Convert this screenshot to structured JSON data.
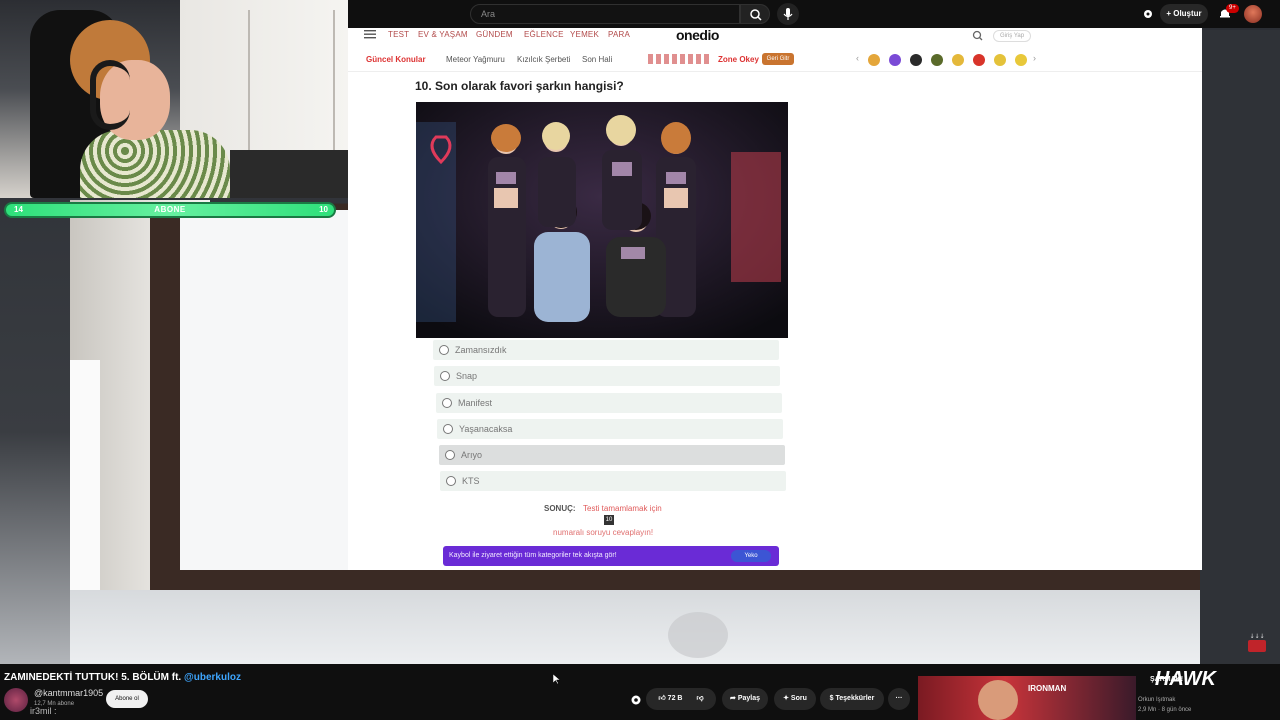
{
  "youtube_bar": {
    "search_placeholder": "Ara",
    "create_label": "Oluştur",
    "notif_badge": "9+"
  },
  "onedio": {
    "nav_top": [
      "TEST",
      "EV & YAŞAM",
      "GÜNDEM",
      "EĞLENCE",
      "YEMEK",
      "PARA"
    ],
    "logo": "onedio",
    "login_label": "Giriş Yap",
    "nav_second": {
      "current_topics": "Güncel Konular",
      "items": [
        "Meteor Yağmuru",
        "Kızılcık Şerbeti",
        "Son Hali"
      ],
      "zone_label": "Zone Okey",
      "zone_button": "Geri Gitr"
    },
    "question": "10. Son olarak favori şarkın hangisi?",
    "options": [
      "Zamansızdık",
      "Snap",
      "Manifest",
      "Yaşanacaksa",
      "Arıyo",
      "KTS"
    ],
    "result_label": "SONUÇ:",
    "result_text": "Testi tamamlamak için",
    "result_count": "10",
    "result_text2": "numaralı soruyu cevaplayın!",
    "promo_text": "Kaybol ile ziyaret ettiğin tüm kategoriler tek akışta gör!",
    "promo_badge": "Yeko"
  },
  "stream_overlay": {
    "goal_left": "14",
    "goal_label": "ABONE",
    "goal_right": "10"
  },
  "video_info": {
    "title_prefix": "ZAMINEDEKTİ TUTTUK! 5. BÖLÜM ft. ",
    "title_mention": "@uberkuloz",
    "channel_name": "@kantmmar1905",
    "channel_subs": "12,7 Mn abone",
    "channel_extra": "ir3mil :",
    "subscribe_label": "Abone ol",
    "likes": "72 B",
    "share_label": "Paylaş",
    "ask_label": "Soru",
    "thanks_label": "Teşekkürler",
    "more_label": "···"
  },
  "sidebar_video": {
    "ad_title": "IRONMAN",
    "title": "ŞARMAK!",
    "channel": "Orkun Işıtmak",
    "meta": "2,9 Mn · 8 gün önce",
    "logo": "HAWK"
  },
  "colors": {
    "goal_green": "#2ee07a",
    "promo_purple": "#6a2bd6",
    "link_blue": "#3ea6ff",
    "onedio_red": "#d33"
  }
}
